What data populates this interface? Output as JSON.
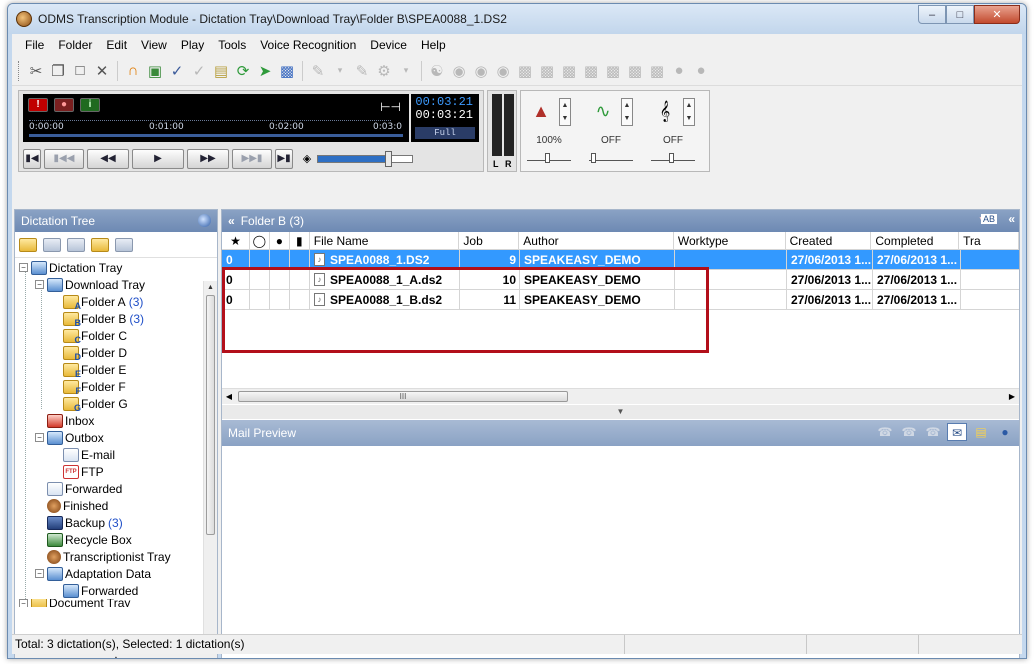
{
  "window": {
    "title": "ODMS Transcription Module - Dictation Tray\\Download Tray\\Folder B\\SPEA0088_1.DS2",
    "buttons": [
      "minimize",
      "maximize",
      "close"
    ]
  },
  "menu": [
    "File",
    "Folder",
    "Edit",
    "View",
    "Play",
    "Tools",
    "Voice Recognition",
    "Device",
    "Help"
  ],
  "toolbar_icons": [
    "cut-icon",
    "copy-icon",
    "paste-icon",
    "delete-icon",
    "headset-icon",
    "properties-icon",
    "finish-icon",
    "pending-icon",
    "book-icon",
    "refresh-icon",
    "send-icon",
    "screen-icon",
    "pen-icon",
    "ftp-icon",
    "settings-icon"
  ],
  "player": {
    "ticks": [
      "0:00:00",
      "0:01:00",
      "0:02:00",
      "0:03:0"
    ],
    "time_current": "00:03:21",
    "time_total": "00:03:21",
    "mode": "Full",
    "meter_left": "L",
    "meter_right": "R",
    "speed": "100%",
    "tone": "OFF",
    "noise": "OFF",
    "volume_level": 0.75
  },
  "tree": {
    "header": "Dictation Tree",
    "items": [
      {
        "label": "Dictation Tray",
        "count": ""
      },
      {
        "label": "Download Tray",
        "count": ""
      },
      {
        "label": "Folder A",
        "count": "(3)"
      },
      {
        "label": "Folder B",
        "count": "(3)"
      },
      {
        "label": "Folder C",
        "count": ""
      },
      {
        "label": "Folder D",
        "count": ""
      },
      {
        "label": "Folder E",
        "count": ""
      },
      {
        "label": "Folder F",
        "count": ""
      },
      {
        "label": "Folder G",
        "count": ""
      },
      {
        "label": "Inbox",
        "count": ""
      },
      {
        "label": "Outbox",
        "count": ""
      },
      {
        "label": "E-mail",
        "count": ""
      },
      {
        "label": "FTP",
        "count": ""
      },
      {
        "label": "Forwarded",
        "count": ""
      },
      {
        "label": "Finished",
        "count": ""
      },
      {
        "label": "Backup",
        "count": "(3)"
      },
      {
        "label": "Recycle Box",
        "count": ""
      },
      {
        "label": "Transcriptionist Tray",
        "count": ""
      },
      {
        "label": "Adaptation Data",
        "count": ""
      },
      {
        "label": "Forwarded",
        "count": ""
      },
      {
        "label": "Document Tray",
        "count": ""
      }
    ],
    "ftp_badge": "FTP"
  },
  "list": {
    "header": "Folder B (3)",
    "columns": [
      "",
      "",
      "",
      "",
      "File Name",
      "Job",
      "Author",
      "Worktype",
      "Created",
      "Completed",
      "Tra"
    ],
    "rows": [
      {
        "priority": "0",
        "file": "SPEA0088_1.DS2",
        "job": "9",
        "author": "SPEAKEASY_DEMO",
        "worktype": "",
        "created": "27/06/2013 1...",
        "completed": "27/06/2013 1...",
        "selected": true
      },
      {
        "priority": "0",
        "file": "SPEA0088_1_A.ds2",
        "job": "10",
        "author": "SPEAKEASY_DEMO",
        "worktype": "",
        "created": "27/06/2013 1...",
        "completed": "27/06/2013 1...",
        "selected": false
      },
      {
        "priority": "0",
        "file": "SPEA0088_1_B.ds2",
        "job": "11",
        "author": "SPEAKEASY_DEMO",
        "worktype": "",
        "created": "27/06/2013 1...",
        "completed": "27/06/2013 1...",
        "selected": false
      }
    ],
    "scroll_grip": "III"
  },
  "mail_preview": {
    "header": "Mail Preview"
  },
  "status": {
    "text": "Total: 3 dictation(s), Selected: 1 dictation(s)"
  },
  "colors": {
    "selection": "#3399ff",
    "highlight_box": "#b20f1a",
    "pane_header": "#7a93bb"
  }
}
